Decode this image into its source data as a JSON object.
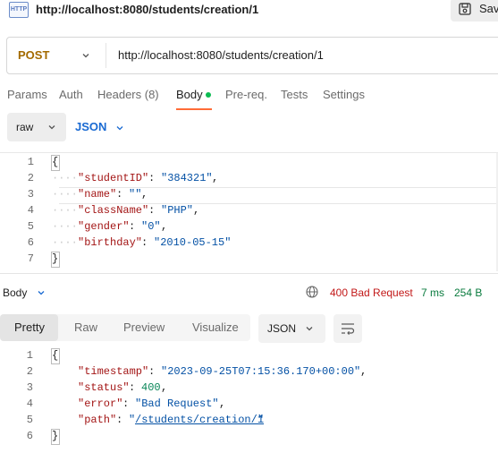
{
  "window": {
    "title": "http://localhost:8080/students/creation/1",
    "badge": "HTTP",
    "save_label": "Save"
  },
  "request": {
    "method": "POST",
    "url": "http://localhost:8080/students/creation/1",
    "tabs": [
      {
        "label": "Params"
      },
      {
        "label": "Auth"
      },
      {
        "label": "Headers (8)"
      },
      {
        "label": "Body"
      },
      {
        "label": "Pre-req."
      },
      {
        "label": "Tests"
      },
      {
        "label": "Settings"
      }
    ],
    "active_tab": "Body",
    "body_mode": "raw",
    "body_format": "JSON",
    "body_lines": {
      "n1": "1",
      "n2": "2",
      "n3": "3",
      "n4": "4",
      "n5": "5",
      "n6": "6",
      "n7": "7",
      "studentID_key": "\"studentID\"",
      "studentID_val": "\"384321\"",
      "name_key": "\"name\"",
      "name_val": "\"\"",
      "className_key": "\"className\"",
      "className_val": "\"PHP\"",
      "gender_key": "\"gender\"",
      "gender_val": "\"0\"",
      "birthday_key": "\"birthday\"",
      "birthday_val": "\"2010-05-15\""
    }
  },
  "response": {
    "section_label": "Body",
    "status": "400 Bad Request",
    "time": "7 ms",
    "size": "254 B",
    "tabs": [
      {
        "label": "Pretty"
      },
      {
        "label": "Raw"
      },
      {
        "label": "Preview"
      },
      {
        "label": "Visualize"
      }
    ],
    "format": "JSON",
    "lines": {
      "n1": "1",
      "n2": "2",
      "n3": "3",
      "n4": "4",
      "n5": "5",
      "n6": "6",
      "timestamp_key": "\"timestamp\"",
      "timestamp_val": "\"2023-09-25T07:15:36.170+00:00\"",
      "status_key": "\"status\"",
      "status_val": "400",
      "error_key": "\"error\"",
      "error_val": "\"Bad Request\"",
      "path_key": "\"path\"",
      "path_quote": "\"",
      "path_link": "/students/creation/1"
    }
  },
  "colors": {
    "accent": "#ff6c37",
    "method": "#a36a00",
    "link": "#1a6ad2",
    "error_status": "#c21818"
  }
}
